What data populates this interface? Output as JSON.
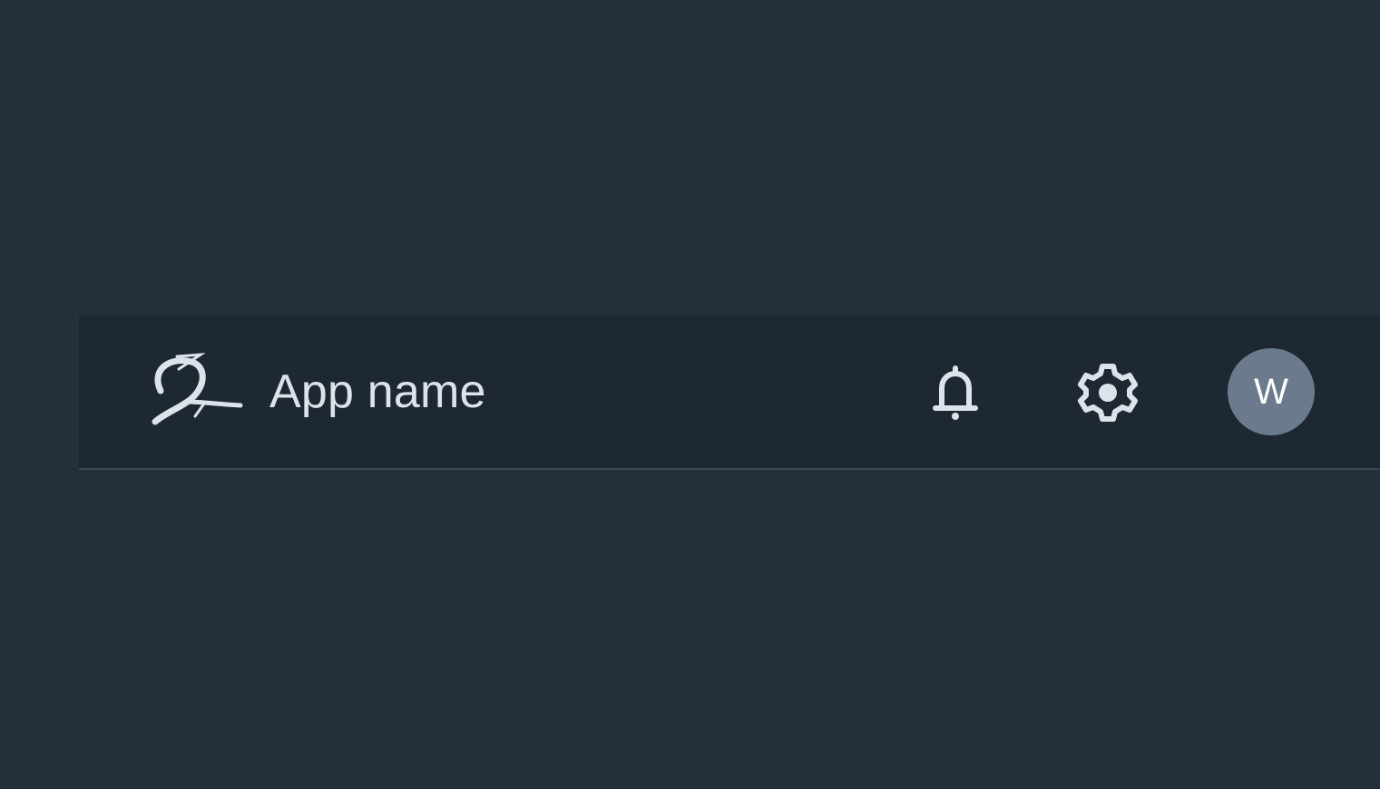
{
  "app_bar": {
    "app_name": "App name",
    "logo": "boeing-style-logo",
    "actions": {
      "notifications_icon": "bell-icon",
      "settings_icon": "gear-icon"
    },
    "user": {
      "initial": "W"
    }
  },
  "colors": {
    "page_background": "#232f3b",
    "app_bar_background": "#1e2832",
    "text": "#dde3ea",
    "avatar_background": "#6b7b8d"
  }
}
